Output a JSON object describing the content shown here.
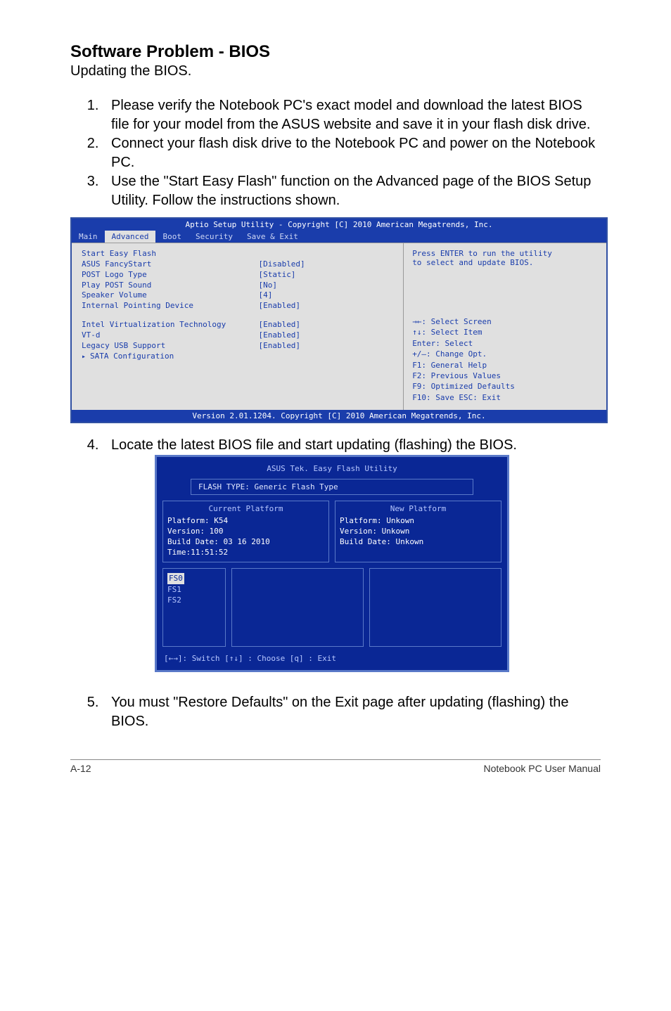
{
  "heading": "Software Problem - BIOS",
  "subheading": "Updating the BIOS.",
  "steps": {
    "s1": "Please verify the Notebook PC's exact model and download the latest BIOS file for your model from the ASUS website and save it in your flash disk drive.",
    "s2": "Connect your flash disk drive to the Notebook PC and power on the Notebook PC.",
    "s3": "Use the \"Start Easy Flash\" function on the Advanced page of the BIOS Setup Utility. Follow the instructions shown.",
    "s4": "Locate the latest BIOS file and start updating (flashing) the BIOS.",
    "s5": "You must \"Restore Defaults\" on the Exit page after updating (flashing) the BIOS."
  },
  "bios": {
    "title": "Aptio Setup Utility - Copyright [C] 2010 American Megatrends, Inc.",
    "tabs": {
      "main": "Main",
      "advanced": "Advanced",
      "boot": "Boot",
      "security": "Security",
      "save": "Save & Exit"
    },
    "items": {
      "i0": "Start Easy Flash",
      "i1": "ASUS FancyStart",
      "i2": "POST Logo Type",
      "i3": "Play POST Sound",
      "i4": "Speaker Volume",
      "i5": "Internal Pointing Device",
      "i6": "Intel Virtualization Technology",
      "i7": "VT-d",
      "i8": "Legacy USB Support",
      "i9": "SATA Configuration"
    },
    "values": {
      "v1": "[Disabled]",
      "v2": "[Static]",
      "v3": "[No]",
      "v4": "[4]",
      "v5": "[Enabled]",
      "v6": "[Enabled]",
      "v7": "[Enabled]",
      "v8": "[Enabled]"
    },
    "help_top_l1": "Press ENTER to run the utility",
    "help_top_l2": "to select and update BIOS.",
    "keys": {
      "k0": "→←:  Select Screen",
      "k1": "↑↓:    Select Item",
      "k2": "Enter: Select",
      "k3": "+/—:  Change Opt.",
      "k4": "F1:    General Help",
      "k5": "F2:    Previous Values",
      "k6": "F9:    Optimized Defaults",
      "k7": "F10:  Save    ESC: Exit"
    },
    "footer": "Version 2.01.1204. Copyright [C] 2010 American Megatrends, Inc."
  },
  "flash": {
    "title": "ASUS Tek. Easy Flash Utility",
    "bar": "FLASH TYPE: Generic Flash Type",
    "current": {
      "title": "Current Platform",
      "l1": "Platform:   K54",
      "l2": "Version:    100",
      "l3": "Build Date: 03 16 2010 Time:11:51:52"
    },
    "new": {
      "title": "New Platform",
      "l1": "Platform:   Unkown",
      "l2": "Version:    Unkown",
      "l3": "Build Date: Unkown"
    },
    "fs": {
      "f0": "FS0",
      "f1": "FS1",
      "f2": "FS2"
    },
    "hints": "[←→]: Switch   [↑↓] : Choose   [q] : Exit"
  },
  "footer": {
    "left": "A-12",
    "right": "Notebook PC User Manual"
  }
}
